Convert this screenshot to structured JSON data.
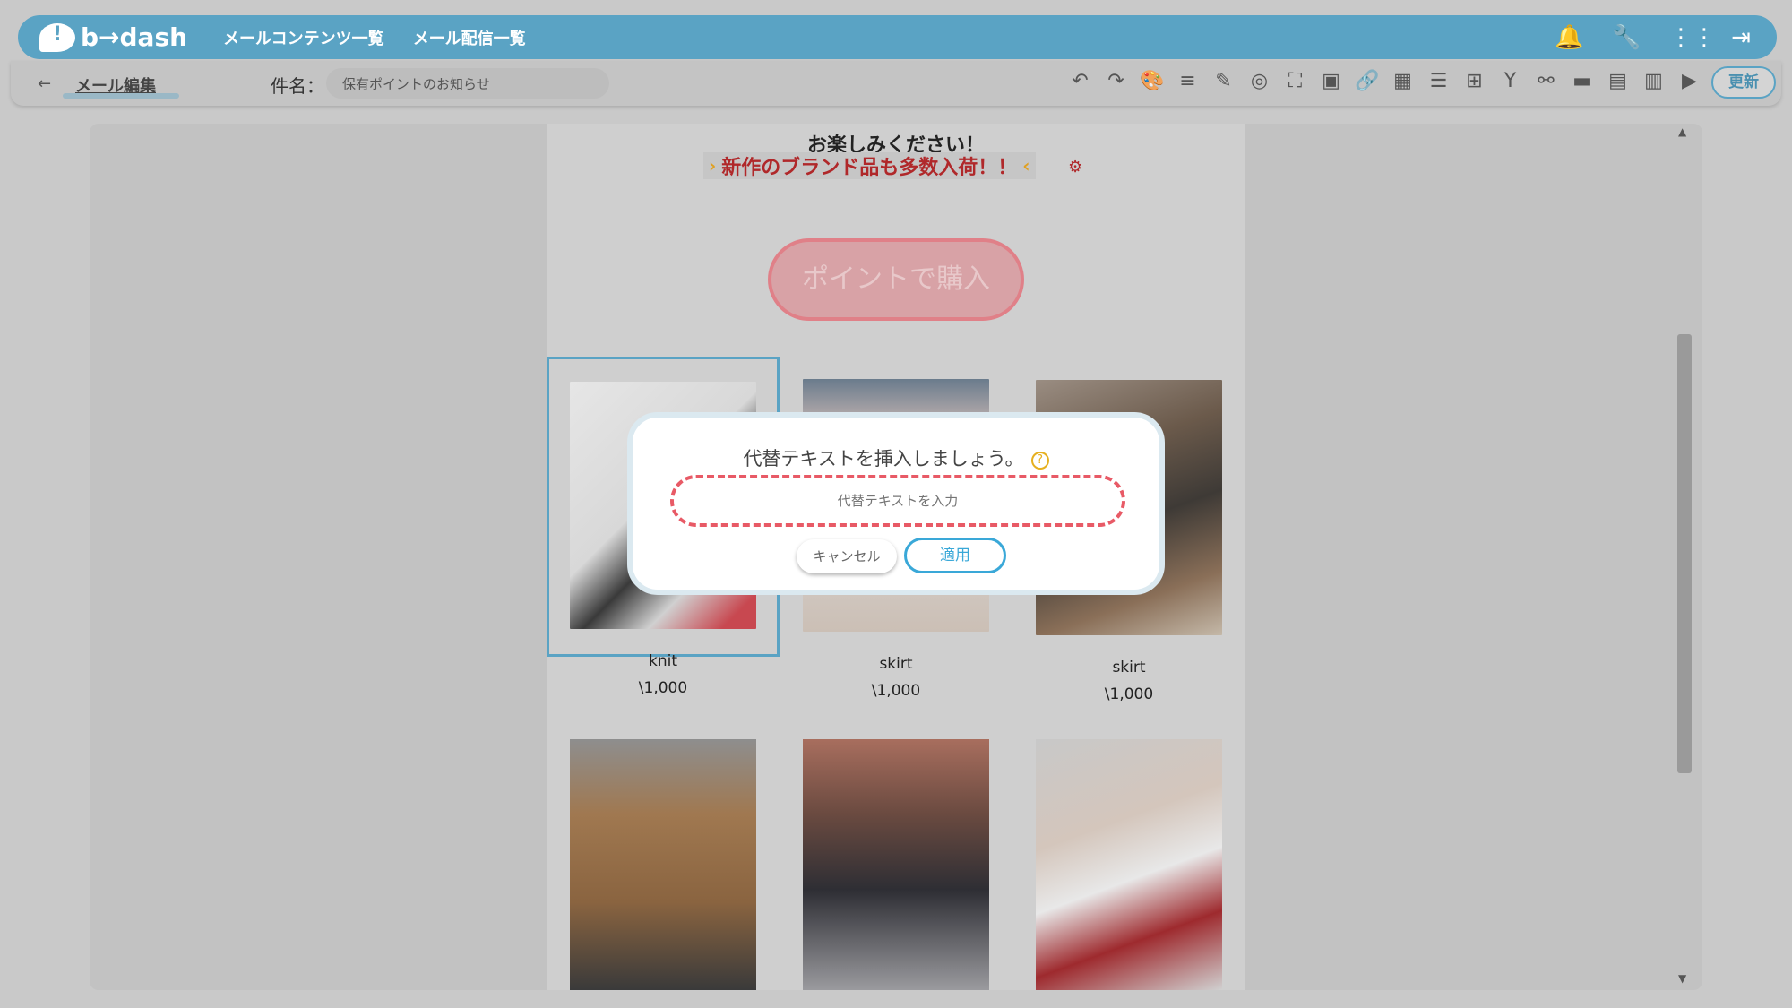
{
  "header": {
    "logo_text": "b→dash",
    "nav": [
      "メールコンテンツ一覧",
      "メール配信一覧"
    ],
    "icons": [
      "bell-icon",
      "wrench-icon",
      "grid-icon",
      "logout-icon"
    ]
  },
  "toolbar": {
    "breadcrumb": "メール編集",
    "subject_label": "件名：",
    "subject_value": "保有ポイントのお知らせ",
    "update_label": "更新"
  },
  "email": {
    "headline": "お楽しみください！",
    "promo": "新作のブランド品も多数入荷！！",
    "cta": "ポイントで購入",
    "products": [
      {
        "name": "knit",
        "price": "\\1,000"
      },
      {
        "name": "skirt",
        "price": "\\1,000"
      },
      {
        "name": "skirt",
        "price": "\\1,000"
      }
    ]
  },
  "modal": {
    "title": "代替テキストを挿入しましょう。",
    "input_placeholder": "代替テキストを入力",
    "cancel_label": "キャンセル",
    "apply_label": "適用"
  },
  "colors": {
    "header_bg": "#5aa3c4",
    "accent": "#3aa8d8",
    "dashed_border": "#e85a66"
  }
}
